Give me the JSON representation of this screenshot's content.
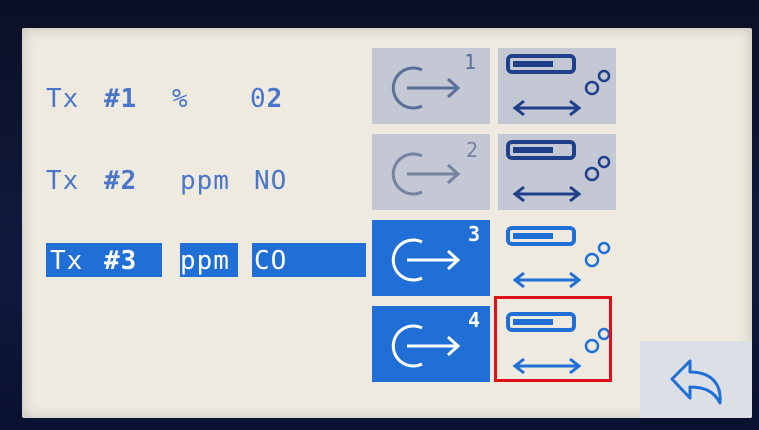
{
  "colors": {
    "accent": "#1f6fd6",
    "text_blue": "#4a76c9",
    "tile_gray": "#c4c8d4",
    "selection_red": "#e0101a",
    "screen_bg": "#eeeae0"
  },
  "transmitters": [
    {
      "tx": "Tx",
      "num": "#1",
      "unit": "%",
      "gas_prefix": "0",
      "gas_suffix": "2",
      "channel": "1"
    },
    {
      "tx": "Tx",
      "num": "#2",
      "unit": "ppm",
      "gas_prefix": "NO",
      "gas_suffix": "",
      "channel": "2"
    },
    {
      "tx": "Tx",
      "num": "#3",
      "unit": "ppm",
      "gas_prefix": "CO",
      "gas_suffix": "",
      "channel": "3"
    },
    {
      "channel": "4"
    }
  ],
  "icons": {
    "enable": "power-arrow-icon",
    "config": "bar-gears-swap-icon",
    "back": "back-arrow-icon"
  }
}
